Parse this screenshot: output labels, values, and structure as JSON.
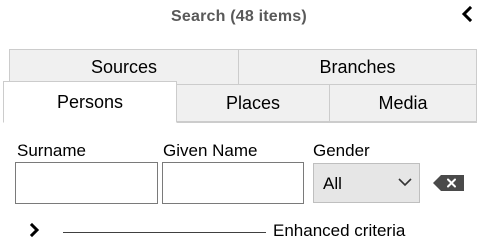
{
  "header": {
    "title": "Search (48 items)",
    "collapse_icon": "chevron-left-icon"
  },
  "tabs": {
    "row_back": [
      {
        "label": "Sources"
      },
      {
        "label": "Branches"
      }
    ],
    "row_front": [
      {
        "label": "Persons",
        "active": true
      },
      {
        "label": "Places",
        "active": false
      },
      {
        "label": "Media",
        "active": false
      }
    ]
  },
  "form": {
    "surname": {
      "label": "Surname",
      "value": ""
    },
    "given_name": {
      "label": "Given Name",
      "value": ""
    },
    "gender": {
      "label": "Gender",
      "selected": "All",
      "icon": "chevron-down-icon"
    },
    "clear_icon": "backspace-clear-icon"
  },
  "enhanced": {
    "label": "Enhanced criteria",
    "expand_icon": "chevron-right-icon",
    "expanded": false
  },
  "colors": {
    "title_text": "#595959",
    "tab_inactive_bg": "#f0f0f0",
    "tab_border": "#cccccc",
    "select_bg": "#e6e6e6",
    "clear_button": "#4a4a4a"
  }
}
